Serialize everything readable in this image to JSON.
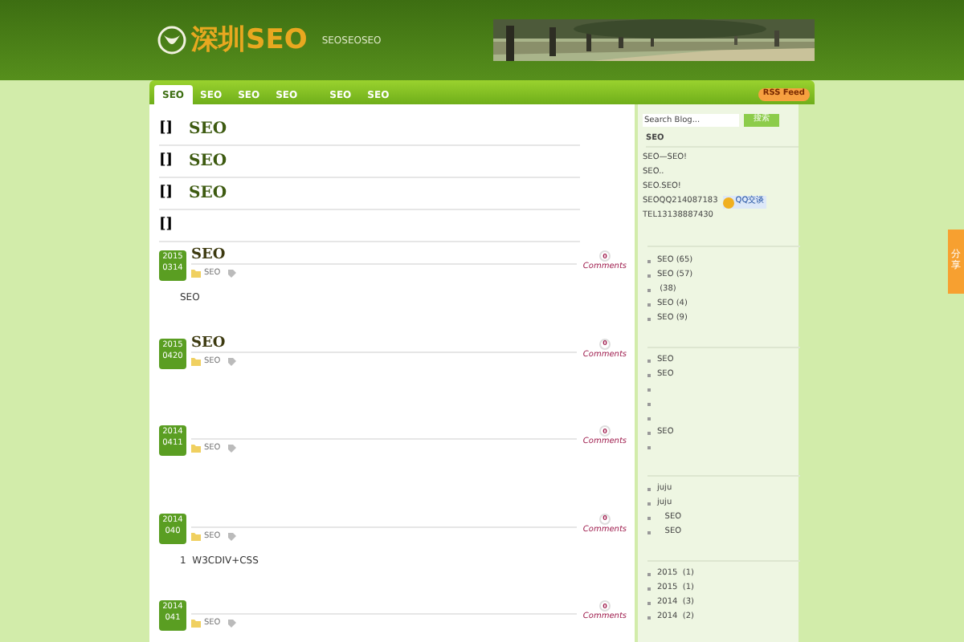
{
  "header": {
    "logo": "深圳SEO",
    "tagline": "SEOSEOSEO"
  },
  "nav": {
    "items": [
      {
        "label": "SEO",
        "selected": true
      },
      {
        "label": "SEO",
        "selected": false
      },
      {
        "label": "SEO",
        "selected": false
      },
      {
        "label": "SEO",
        "selected": false
      },
      {
        "label": "SEO",
        "selected": false
      },
      {
        "label": "SEO",
        "selected": false
      }
    ],
    "rss": "RSS Feed"
  },
  "sticky_posts": [
    {
      "mark": "[]",
      "title": "SEO"
    },
    {
      "mark": "[]",
      "title": "SEO"
    },
    {
      "mark": "[]",
      "title": "SEO"
    },
    {
      "mark": "[]"
    }
  ],
  "posts": [
    {
      "year": "2015",
      "day": "0314",
      "title": "SEO",
      "category": "SEO",
      "comments_count": "0",
      "comments_label": "Comments",
      "excerpt": "SEO"
    },
    {
      "year": "2015",
      "day": "0420",
      "title": "SEO",
      "category": "SEO",
      "comments_count": "0",
      "comments_label": "Comments"
    },
    {
      "year": "2014",
      "day": "0411",
      "category": "SEO",
      "comments_count": "0",
      "comments_label": "Comments"
    },
    {
      "year": "2014",
      "day": "040",
      "category": "SEO",
      "comments_count": "0",
      "comments_label": "Comments",
      "excerpt": "1  W3CDIV+CSS"
    },
    {
      "year": "2014",
      "day": "041",
      "category": "SEO",
      "comments_count": "0",
      "comments_label": "Comments"
    }
  ],
  "sidebar": {
    "search": {
      "placeholder": "Search Blog...",
      "button": "搜索"
    },
    "about": {
      "title": "SEO",
      "lines": [
        "SEO—SEO!",
        "SEO..",
        "SEO.SEO!"
      ],
      "qq": "SEOQQ214087183",
      "qq_button": "QQ交谈",
      "tel": "TEL13138887430"
    },
    "sections": [
      {
        "items": [
          {
            "kind": "text",
            "label": "SEO (65)"
          },
          {
            "kind": "text",
            "label": "SEO (57)"
          },
          {
            "kind": "text",
            "label": " (38)"
          },
          {
            "kind": "text",
            "label": "SEO (4)"
          },
          {
            "kind": "text",
            "label": "SEO (9)"
          }
        ]
      },
      {
        "items": [
          {
            "kind": "text",
            "label": "SEO"
          },
          {
            "kind": "text",
            "label": "SEO"
          },
          {
            "kind": "empty"
          },
          {
            "kind": "empty"
          },
          {
            "kind": "empty"
          },
          {
            "kind": "text",
            "label": "SEO"
          },
          {
            "kind": "empty"
          }
        ]
      },
      {
        "items": [
          {
            "kind": "text",
            "label": "juju"
          },
          {
            "kind": "text",
            "label": "juju"
          },
          {
            "kind": "text",
            "label": "   SEO"
          },
          {
            "kind": "text",
            "label": "   SEO"
          }
        ]
      },
      {
        "items": [
          {
            "kind": "text",
            "label": "2015  (1)"
          },
          {
            "kind": "text",
            "label": "2015  (1)"
          },
          {
            "kind": "text",
            "label": "2014  (3)"
          },
          {
            "kind": "text",
            "label": "2014  (2)"
          }
        ]
      }
    ]
  },
  "share_tab": "分享"
}
